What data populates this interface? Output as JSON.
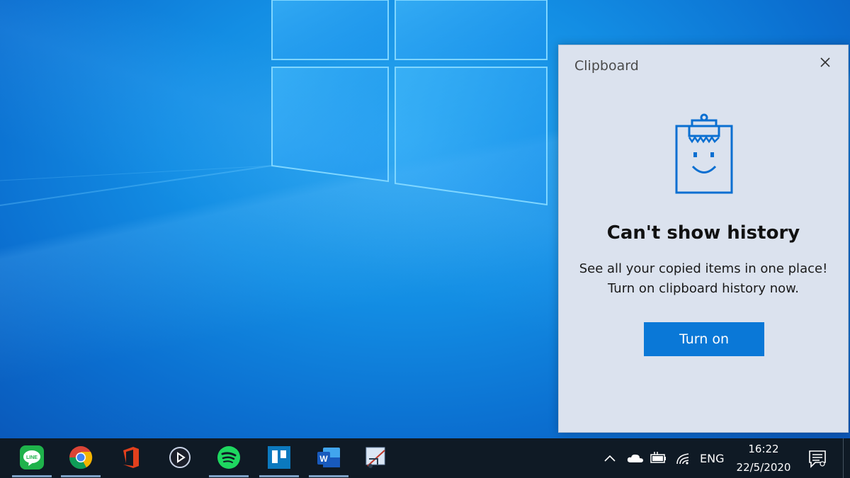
{
  "clipboard": {
    "title": "Clipboard",
    "heading": "Can't show history",
    "body_line1": "See all your copied items in one place!",
    "body_line2": "Turn on clipboard history now.",
    "button_label": "Turn on",
    "accent_color": "#0a78d7"
  },
  "taskbar": {
    "apps": [
      "LINE",
      "Google Chrome",
      "Office",
      "Media player",
      "Spotify",
      "Trello",
      "Word",
      "Snipping tool"
    ],
    "tray": {
      "language": "ENG",
      "time": "16:22",
      "date": "22/5/2020"
    }
  }
}
